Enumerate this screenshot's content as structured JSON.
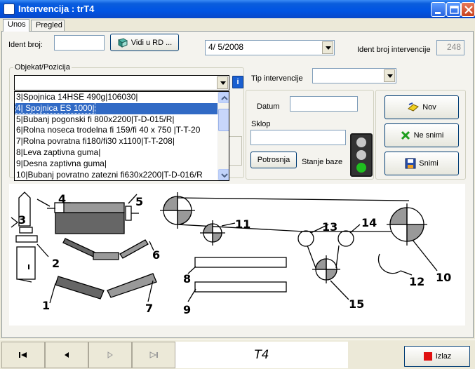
{
  "window": {
    "title": "Intervencija : trT4"
  },
  "tabs": [
    {
      "label": "Unos",
      "active": true
    },
    {
      "label": "Pregled",
      "active": false
    }
  ],
  "form": {
    "ident_broj_label": "Ident broj:",
    "ident_broj_value": "",
    "vidi_rd_label": "Vidi u RD ...",
    "date_value": "4/  5/2008",
    "ident_broj_intervencije_label": "Ident broj intervencije",
    "ident_broj_intervencije_value": "248",
    "objekat_pozicija_label": "Objekat/Pozicija",
    "objekat_value": "",
    "info_label": "i",
    "tip_intervencije_label": "Tip intervencije",
    "tip_intervencije_value": "",
    "datum_label": "Datum",
    "datum_value": "",
    "sklop_label": "Sklop",
    "sklop_value": "",
    "potrosnja_label": "Potrosnja",
    "stanje_baze_label": "Stanje baze"
  },
  "objekat_list": [
    "3|Spojnica 14HSE 490g|106030|",
    "4| Spojnica ES 1000|",
    "5|Bubanj pogonski fi 800x2200|T-D-015/R|",
    "6|Rolna noseca trodelna fi 159/fi 40 x 750 |T-T-20",
    "7|Rolna povratna fi180/fi30 x1100|T-T-208|",
    "8|Leva zaptivna guma|",
    "9|Desna zaptivna guma|",
    "10|Bubanj povratno zatezni fi630x2200|T-D-016/R"
  ],
  "objekat_selected_index": 1,
  "actions": {
    "nov": "Nov",
    "ne_snimi": "Ne snimi",
    "snimi": "Snimi"
  },
  "traffic_light": {
    "active": "green",
    "colors": {
      "off": "#c8c8c8",
      "green": "#1fbf1f"
    }
  },
  "diagram_labels": [
    "1",
    "2",
    "3",
    "4",
    "5",
    "6",
    "7",
    "8",
    "9",
    "10",
    "11",
    "12",
    "13",
    "14",
    "15"
  ],
  "navigation": {
    "record_label": "T4",
    "exit_label": "Izlaz"
  }
}
